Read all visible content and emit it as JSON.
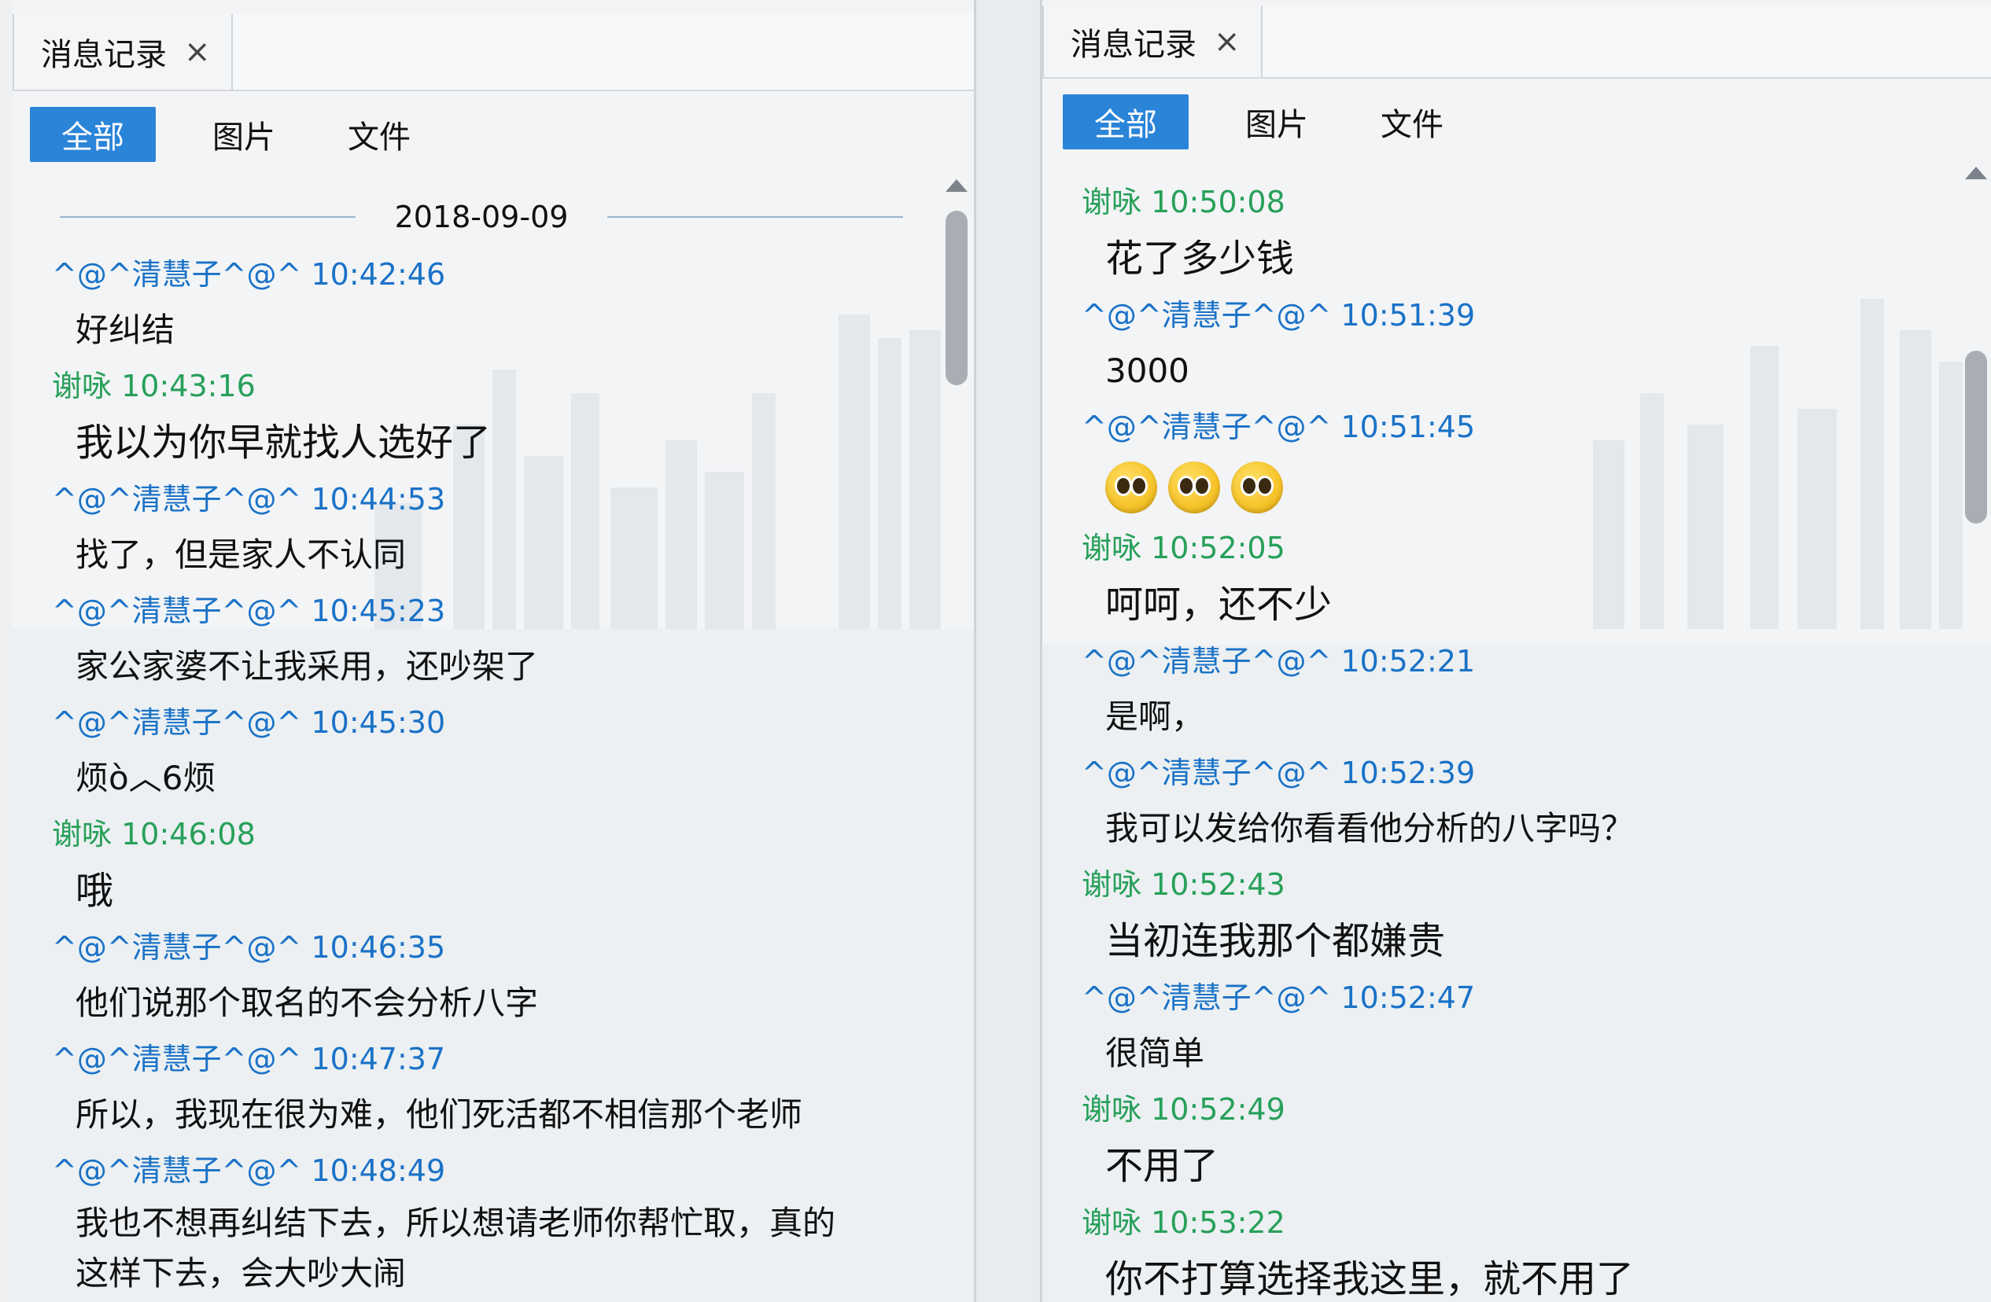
{
  "left": {
    "tab_title": "消息记录",
    "close_glyph": "×",
    "filters": [
      "全部",
      "图片",
      "文件"
    ],
    "date": "2018-09-09",
    "messages": [
      {
        "sender": "^@^清慧子^@^",
        "time": "10:42:46",
        "text": "好纠结",
        "color": "blue"
      },
      {
        "sender": "谢咏",
        "time": "10:43:16",
        "text": "我以为你早就找人选好了",
        "color": "green"
      },
      {
        "sender": "^@^清慧子^@^",
        "time": "10:44:53",
        "text": "找了，但是家人不认同",
        "color": "blue"
      },
      {
        "sender": "^@^清慧子^@^",
        "time": "10:45:23",
        "text": "家公家婆不让我采用，还吵架了",
        "color": "blue"
      },
      {
        "sender": "^@^清慧子^@^",
        "time": "10:45:30",
        "text": "烦ò︿6烦",
        "color": "blue"
      },
      {
        "sender": "谢咏",
        "time": "10:46:08",
        "text": "哦",
        "color": "green"
      },
      {
        "sender": "^@^清慧子^@^",
        "time": "10:46:35",
        "text": "他们说那个取名的不会分析八字",
        "color": "blue"
      },
      {
        "sender": "^@^清慧子^@^",
        "time": "10:47:37",
        "text": "所以，我现在很为难，他们死活都不相信那个老师",
        "color": "blue"
      },
      {
        "sender": "^@^清慧子^@^",
        "time": "10:48:49",
        "text_lines": [
          "我也不想再纠结下去，所以想请老师你帮忙取，真的",
          "这样下去，会大吵大闹"
        ],
        "color": "blue"
      }
    ]
  },
  "right": {
    "tab_title": "消息记录",
    "close_glyph": "×",
    "filters": [
      "全部",
      "图片",
      "文件"
    ],
    "messages": [
      {
        "sender": "谢咏",
        "time": "10:50:08",
        "text": "花了多少钱",
        "color": "green"
      },
      {
        "sender": "^@^清慧子^@^",
        "time": "10:51:39",
        "text": "3000",
        "color": "blue"
      },
      {
        "sender": "^@^清慧子^@^",
        "time": "10:51:45",
        "emoji_count": 3,
        "color": "blue"
      },
      {
        "sender": "谢咏",
        "time": "10:52:05",
        "text": "呵呵，还不少",
        "color": "green"
      },
      {
        "sender": "^@^清慧子^@^",
        "time": "10:52:21",
        "text": "是啊，",
        "color": "blue"
      },
      {
        "sender": "^@^清慧子^@^",
        "time": "10:52:39",
        "text": "我可以发给你看看他分析的八字吗？",
        "color": "blue"
      },
      {
        "sender": "谢咏",
        "time": "10:52:43",
        "text": "当初连我那个都嫌贵",
        "color": "green"
      },
      {
        "sender": "^@^清慧子^@^",
        "time": "10:52:47",
        "text": "很简单",
        "color": "blue"
      },
      {
        "sender": "谢咏",
        "time": "10:52:49",
        "text": "不用了",
        "color": "green"
      },
      {
        "sender": "谢咏",
        "time": "10:53:22",
        "text": "你不打算选择我这里，就不用了",
        "color": "green"
      }
    ]
  }
}
